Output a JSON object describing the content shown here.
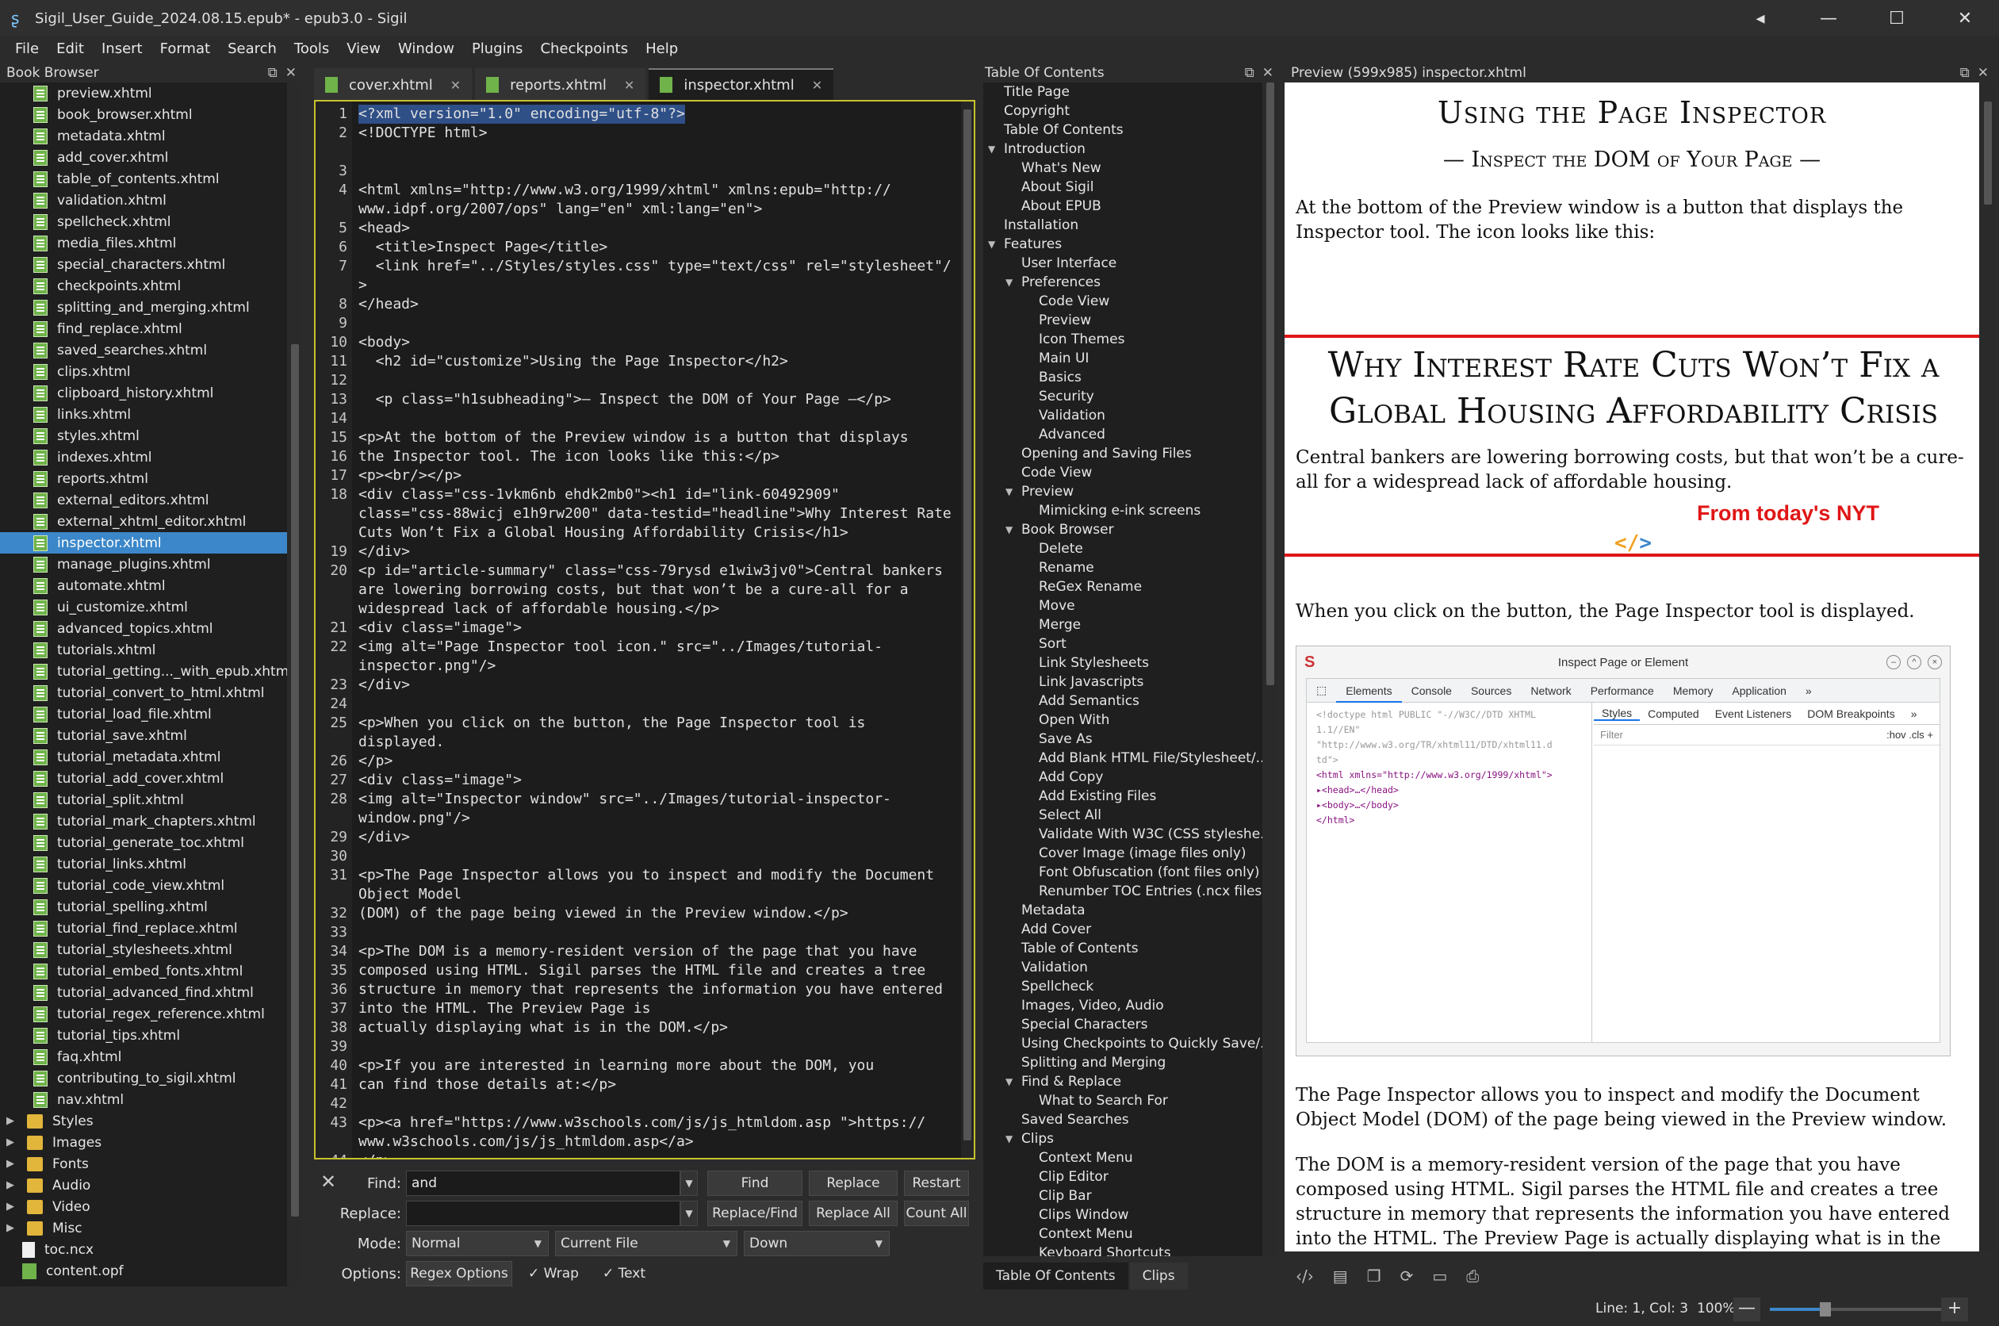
{
  "window": {
    "title": "Sigil_User_Guide_2024.08.15.epub* - epub3.0 - Sigil",
    "controls": [
      "◂",
      "—",
      "☐",
      "✕"
    ]
  },
  "menu": [
    "File",
    "Edit",
    "Insert",
    "Format",
    "Search",
    "Tools",
    "View",
    "Window",
    "Plugins",
    "Checkpoints",
    "Help"
  ],
  "book_browser": {
    "title": "Book Browser",
    "files": [
      "preview.xhtml",
      "book_browser.xhtml",
      "metadata.xhtml",
      "add_cover.xhtml",
      "table_of_contents.xhtml",
      "validation.xhtml",
      "spellcheck.xhtml",
      "media_files.xhtml",
      "special_characters.xhtml",
      "checkpoints.xhtml",
      "splitting_and_merging.xhtml",
      "find_replace.xhtml",
      "saved_searches.xhtml",
      "clips.xhtml",
      "clipboard_history.xhtml",
      "links.xhtml",
      "styles.xhtml",
      "indexes.xhtml",
      "reports.xhtml",
      "external_editors.xhtml",
      "external_xhtml_editor.xhtml",
      "inspector.xhtml",
      "manage_plugins.xhtml",
      "automate.xhtml",
      "ui_customize.xhtml",
      "advanced_topics.xhtml",
      "tutorials.xhtml",
      "tutorial_getting..._with_epub.xhtml",
      "tutorial_convert_to_html.xhtml",
      "tutorial_load_file.xhtml",
      "tutorial_save.xhtml",
      "tutorial_metadata.xhtml",
      "tutorial_add_cover.xhtml",
      "tutorial_split.xhtml",
      "tutorial_mark_chapters.xhtml",
      "tutorial_generate_toc.xhtml",
      "tutorial_links.xhtml",
      "tutorial_code_view.xhtml",
      "tutorial_spelling.xhtml",
      "tutorial_find_replace.xhtml",
      "tutorial_stylesheets.xhtml",
      "tutorial_embed_fonts.xhtml",
      "tutorial_advanced_find.xhtml",
      "tutorial_regex_reference.xhtml",
      "tutorial_tips.xhtml",
      "faq.xhtml",
      "contributing_to_sigil.xhtml",
      "nav.xhtml"
    ],
    "selected": "inspector.xhtml",
    "folders": [
      "Styles",
      "Images",
      "Fonts",
      "Audio",
      "Video",
      "Misc"
    ],
    "extra_files": [
      "toc.ncx",
      "content.opf"
    ]
  },
  "tabs": [
    {
      "label": "cover.xhtml",
      "active": false
    },
    {
      "label": "reports.xhtml",
      "active": false
    },
    {
      "label": "inspector.xhtml",
      "active": true
    }
  ],
  "code_lines": [
    {
      "n": "1",
      "t": "<?xml version=\"1.0\" encoding=\"utf-8\"?>",
      "hl": true
    },
    {
      "n": "2",
      "t": "<!DOCTYPE html>"
    },
    {
      "n": "",
      "t": ""
    },
    {
      "n": "3",
      "t": ""
    },
    {
      "n": "4",
      "t": "<html xmlns=\"http://www.w3.org/1999/xhtml\" xmlns:epub=\"http://"
    },
    {
      "n": "",
      "t": "www.idpf.org/2007/ops\" lang=\"en\" xml:lang=\"en\">"
    },
    {
      "n": "5",
      "t": "<head>"
    },
    {
      "n": "6",
      "t": "  <title>Inspect Page</title>"
    },
    {
      "n": "7",
      "t": "  <link href=\"../Styles/styles.css\" type=\"text/css\" rel=\"stylesheet\"/"
    },
    {
      "n": "",
      "t": ">"
    },
    {
      "n": "8",
      "t": "</head>"
    },
    {
      "n": "9",
      "t": ""
    },
    {
      "n": "10",
      "t": "<body>"
    },
    {
      "n": "11",
      "t": "  <h2 id=\"customize\">Using the Page Inspector</h2>"
    },
    {
      "n": "12",
      "t": ""
    },
    {
      "n": "13",
      "t": "  <p class=\"h1subheading\">— Inspect the DOM of Your Page —</p>"
    },
    {
      "n": "14",
      "t": ""
    },
    {
      "n": "15",
      "t": "<p>At the bottom of the Preview window is a button that displays"
    },
    {
      "n": "16",
      "t": "the Inspector tool. The icon looks like this:</p>"
    },
    {
      "n": "17",
      "t": "<p><br/></p>"
    },
    {
      "n": "18",
      "t": "<div class=\"css-1vkm6nb ehdk2mb0\"><h1 id=\"link-60492909\""
    },
    {
      "n": "",
      "t": "class=\"css-88wicj e1h9rw200\" data-testid=\"headline\">Why Interest Rate"
    },
    {
      "n": "",
      "t": "Cuts Won’t Fix a Global Housing Affordability Crisis</h1>"
    },
    {
      "n": "19",
      "t": "</div>"
    },
    {
      "n": "20",
      "t": "<p id=\"article-summary\" class=\"css-79rysd e1wiw3jv0\">Central bankers"
    },
    {
      "n": "",
      "t": "are lowering borrowing costs, but that won’t be a cure-all for a"
    },
    {
      "n": "",
      "t": "widespread lack of affordable housing.</p>"
    },
    {
      "n": "21",
      "t": "<div class=\"image\">"
    },
    {
      "n": "22",
      "t": "<img alt=\"Page Inspector tool icon.\" src=\"../Images/tutorial-"
    },
    {
      "n": "",
      "t": "inspector.png\"/>"
    },
    {
      "n": "23",
      "t": "</div>"
    },
    {
      "n": "24",
      "t": ""
    },
    {
      "n": "25",
      "t": "<p>When you click on the button, the Page Inspector tool is"
    },
    {
      "n": "",
      "t": "displayed."
    },
    {
      "n": "26",
      "t": "</p>"
    },
    {
      "n": "27",
      "t": "<div class=\"image\">"
    },
    {
      "n": "28",
      "t": "<img alt=\"Inspector window\" src=\"../Images/tutorial-inspector-"
    },
    {
      "n": "",
      "t": "window.png\"/>"
    },
    {
      "n": "29",
      "t": "</div>"
    },
    {
      "n": "30",
      "t": ""
    },
    {
      "n": "31",
      "t": "<p>The Page Inspector allows you to inspect and modify the Document"
    },
    {
      "n": "",
      "t": "Object Model"
    },
    {
      "n": "32",
      "t": "(DOM) of the page being viewed in the Preview window.</p>"
    },
    {
      "n": "33",
      "t": ""
    },
    {
      "n": "34",
      "t": "<p>The DOM is a memory-resident version of the page that you have"
    },
    {
      "n": "35",
      "t": "composed using HTML. Sigil parses the HTML file and creates a tree"
    },
    {
      "n": "36",
      "t": "structure in memory that represents the information you have entered"
    },
    {
      "n": "37",
      "t": "into the HTML. The Preview Page is"
    },
    {
      "n": "38",
      "t": "actually displaying what is in the DOM.</p>"
    },
    {
      "n": "39",
      "t": ""
    },
    {
      "n": "40",
      "t": "<p>If you are interested in learning more about the DOM, you"
    },
    {
      "n": "41",
      "t": "can find those details at:</p>"
    },
    {
      "n": "42",
      "t": ""
    },
    {
      "n": "43",
      "t": "<p><a href=\"https://www.w3schools.com/js/js_htmldom.asp \">https://"
    },
    {
      "n": "",
      "t": "www.w3schools.com/js/js_htmldom.asp</a>"
    },
    {
      "n": "44",
      "t": "</p>"
    }
  ],
  "find": {
    "find_label": "Find:",
    "find_value": "and",
    "replace_label": "Replace:",
    "replace_value": "",
    "mode_label": "Mode:",
    "mode_value": "Normal",
    "scope_value": "Current File",
    "direction_value": "Down",
    "options_label": "Options:",
    "regex_options": "Regex Options",
    "wrap_label": "Wrap",
    "text_label": "Text",
    "buttons": {
      "find": "Find",
      "replace": "Replace",
      "restart": "Restart",
      "replace_find": "Replace/Find",
      "replace_all": "Replace All",
      "count_all": "Count All"
    }
  },
  "toc": {
    "title": "Table Of Contents",
    "items": [
      {
        "label": "Title Page",
        "level": 0
      },
      {
        "label": "Copyright",
        "level": 0
      },
      {
        "label": "Table Of Contents",
        "level": 0
      },
      {
        "label": "Introduction",
        "level": 0,
        "expanded": true
      },
      {
        "label": "What's New",
        "level": 1
      },
      {
        "label": "About Sigil",
        "level": 1
      },
      {
        "label": "About EPUB",
        "level": 1
      },
      {
        "label": "Installation",
        "level": 0
      },
      {
        "label": "Features",
        "level": 0,
        "expanded": true
      },
      {
        "label": "User Interface",
        "level": 1
      },
      {
        "label": "Preferences",
        "level": 1,
        "expanded": true
      },
      {
        "label": "Code View",
        "level": 2
      },
      {
        "label": "Preview",
        "level": 2
      },
      {
        "label": "Icon Themes",
        "level": 2
      },
      {
        "label": "Main UI",
        "level": 2
      },
      {
        "label": "Basics",
        "level": 2
      },
      {
        "label": "Security",
        "level": 2
      },
      {
        "label": "Validation",
        "level": 2
      },
      {
        "label": "Advanced",
        "level": 2
      },
      {
        "label": "Opening and Saving Files",
        "level": 1
      },
      {
        "label": "Code View",
        "level": 1
      },
      {
        "label": "Preview",
        "level": 1,
        "expanded": true
      },
      {
        "label": "Mimicking e-ink screens",
        "level": 2
      },
      {
        "label": "Book Browser",
        "level": 1,
        "expanded": true
      },
      {
        "label": "Delete",
        "level": 2
      },
      {
        "label": "Rename",
        "level": 2
      },
      {
        "label": "ReGex Rename",
        "level": 2
      },
      {
        "label": "Move",
        "level": 2
      },
      {
        "label": "Merge",
        "level": 2
      },
      {
        "label": "Sort",
        "level": 2
      },
      {
        "label": "Link Stylesheets",
        "level": 2
      },
      {
        "label": "Link Javascripts",
        "level": 2
      },
      {
        "label": "Add Semantics",
        "level": 2
      },
      {
        "label": "Open With",
        "level": 2
      },
      {
        "label": "Save As",
        "level": 2
      },
      {
        "label": "Add Blank HTML File/Stylesheet/...",
        "level": 2
      },
      {
        "label": "Add Copy",
        "level": 2
      },
      {
        "label": "Add Existing Files",
        "level": 2
      },
      {
        "label": "Select All",
        "level": 2
      },
      {
        "label": "Validate With W3C (CSS styleshe...",
        "level": 2
      },
      {
        "label": "Cover Image (image files only)",
        "level": 2
      },
      {
        "label": "Font Obfuscation (font files only)",
        "level": 2
      },
      {
        "label": "Renumber TOC Entries (.ncx files...",
        "level": 2
      },
      {
        "label": "Metadata",
        "level": 1
      },
      {
        "label": "Add Cover",
        "level": 1
      },
      {
        "label": "Table of Contents",
        "level": 1
      },
      {
        "label": "Validation",
        "level": 1
      },
      {
        "label": "Spellcheck",
        "level": 1
      },
      {
        "label": "Images, Video, Audio",
        "level": 1
      },
      {
        "label": "Special Characters",
        "level": 1
      },
      {
        "label": "Using Checkpoints to Quickly Save/...",
        "level": 1
      },
      {
        "label": "Splitting and Merging",
        "level": 1
      },
      {
        "label": "Find & Replace",
        "level": 1,
        "expanded": true
      },
      {
        "label": "What to Search For",
        "level": 2
      },
      {
        "label": "Saved Searches",
        "level": 1
      },
      {
        "label": "Clips",
        "level": 1,
        "expanded": true
      },
      {
        "label": "Context Menu",
        "level": 2
      },
      {
        "label": "Clip Editor",
        "level": 2
      },
      {
        "label": "Clip Bar",
        "level": 2
      },
      {
        "label": "Clips Window",
        "level": 2
      },
      {
        "label": "Context Menu",
        "level": 2
      },
      {
        "label": "Keyboard Shortcuts",
        "level": 2
      }
    ],
    "bottom_tabs": [
      "Table Of Contents",
      "Clips"
    ]
  },
  "preview": {
    "title": "Preview (599x985) inspector.xhtml",
    "h2": "Using the Page Inspector",
    "subheading": "— Inspect the DOM of Your Page —",
    "p1": "At the bottom of the Preview window is a button that displays the Inspector tool. The icon looks like this:",
    "callout_h1": "Why Interest Rate Cuts Won’t Fix a Global Housing Affordability Crisis",
    "callout_p": "Central bankers are lowering borrowing costs, but that won’t be a cure-all for a widespread lack of affordable housing.",
    "callout_note": "From today's NYT",
    "code_icon_left": "</",
    "code_icon_right": ">",
    "p2": "When you click on the button, the Page Inspector tool is displayed.",
    "p3": "The Page Inspector allows you to inspect and modify the Document Object Model (DOM) of the page being viewed in the Preview window.",
    "p4": "The DOM is a memory-resident version of the page that you have composed using HTML. Sigil parses the HTML file and creates a tree structure in memory that represents the information you have entered into the HTML. The Preview Page is actually displaying what is in the DOM.",
    "inspector": {
      "title": "Inspect Page or Element",
      "tabs": [
        "Elements",
        "Console",
        "Sources",
        "Network",
        "Performance",
        "Memory",
        "Application",
        "»"
      ],
      "right_tabs": [
        "Styles",
        "Computed",
        "Event Listeners",
        "DOM Breakpoints",
        "»"
      ],
      "filter": "Filter",
      "filter_right": ":hov  .cls  +",
      "dom": [
        "<!doctype html PUBLIC \"-//W3C//DTD XHTML",
        "1.1//EN\"",
        "\"http://www.w3.org/TR/xhtml11/DTD/xhtml11.d",
        "td\">",
        "<html xmlns=\"http://www.w3.org/1999/xhtml\">",
        "▸<head>…</head>",
        "▸<body>…</body>",
        "</html>"
      ]
    },
    "toolbar_icons": [
      "code-inspector-icon",
      "page-icon",
      "copy-icon",
      "reload-icon",
      "inspect-icon",
      "print-icon"
    ]
  },
  "status": {
    "position": "Line: 1, Col: 3",
    "zoom": "100%",
    "zoom_level": 0.3
  }
}
